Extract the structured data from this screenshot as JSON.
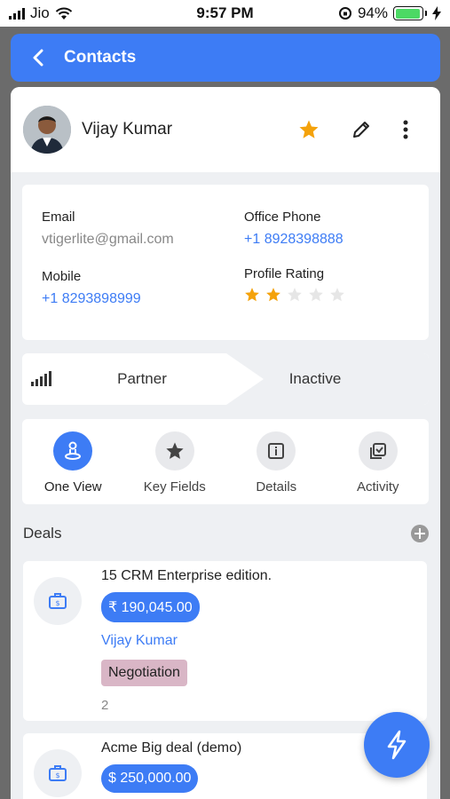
{
  "status_bar": {
    "carrier": "Jio",
    "time": "9:57 PM",
    "battery": "94%",
    "battery_level": 0.94
  },
  "header": {
    "title": "Contacts",
    "back_icon": "chevron-left-icon"
  },
  "profile": {
    "name": "Vijay Kumar",
    "favorite": true
  },
  "info": {
    "email_label": "Email",
    "email_value": "vtigerlite@gmail.com",
    "office_phone_label": "Office Phone",
    "office_phone_value": "+1 8928398888",
    "mobile_label": "Mobile",
    "mobile_value": "+1 8293898999",
    "rating_label": "Profile Rating",
    "rating_value": 2,
    "rating_max": 5
  },
  "stage": {
    "first": "Partner",
    "second": "Inactive"
  },
  "tabs": [
    {
      "label": "One View",
      "icon": "one-view-icon",
      "active": true
    },
    {
      "label": "Key Fields",
      "icon": "star-icon",
      "active": false
    },
    {
      "label": "Details",
      "icon": "info-icon",
      "active": false
    },
    {
      "label": "Activity",
      "icon": "activity-icon",
      "active": false
    }
  ],
  "deals": {
    "title": "Deals",
    "items": [
      {
        "name": "15 CRM Enterprise edition.",
        "amount": "₹ 190,045.00",
        "contact": "Vijay Kumar",
        "stage": "Negotiation",
        "count": "2"
      },
      {
        "name": "Acme Big deal (demo)",
        "amount": "$ 250,000.00"
      }
    ]
  },
  "colors": {
    "accent": "#3d7cf5",
    "star": "#f4a20b",
    "negotiation_badge": "#d9b6c6"
  }
}
